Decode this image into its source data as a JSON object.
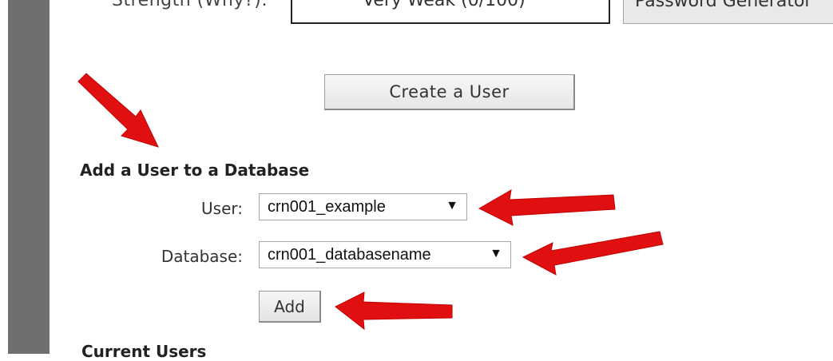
{
  "password_row": {
    "strength_label": "Strength (Why?):",
    "strength_value": "Very Weak (0/100)",
    "generator_button": "Password Generator"
  },
  "create_user": {
    "button_label": "Create a User"
  },
  "add_user_to_db": {
    "title": "Add a User to a Database",
    "user_label": "User:",
    "user_value": "crn001_example",
    "database_label": "Database:",
    "database_value": "crn001_databasename",
    "add_button": "Add"
  },
  "current_users": {
    "title": "Current Users"
  },
  "icons": {
    "dropdown": "▼"
  },
  "colors": {
    "arrow": "#e01010",
    "sidebar": "#6f6f6f"
  }
}
